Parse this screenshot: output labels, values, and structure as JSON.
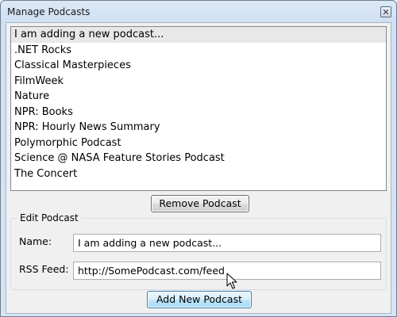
{
  "window": {
    "title": "Manage Podcasts",
    "close_glyph": "✕"
  },
  "list": {
    "items": [
      "I am adding a new podcast...",
      ".NET Rocks",
      "Classical Masterpieces",
      "FilmWeek",
      "Nature",
      "NPR: Books",
      "NPR: Hourly News Summary",
      "Polymorphic Podcast",
      "Science @ NASA Feature Stories Podcast",
      "The Concert"
    ],
    "selected_index": 0
  },
  "buttons": {
    "remove": "Remove Podcast",
    "add": "Add New Podcast"
  },
  "edit": {
    "legend": "Edit Podcast",
    "name_label": "Name:",
    "name_value": "I am adding a new podcast...",
    "rss_label": "RSS Feed:",
    "rss_value": "http://SomePodcast.com/feed"
  },
  "icons": {
    "close": "close-icon",
    "cursor": "mouse-pointer-icon"
  }
}
